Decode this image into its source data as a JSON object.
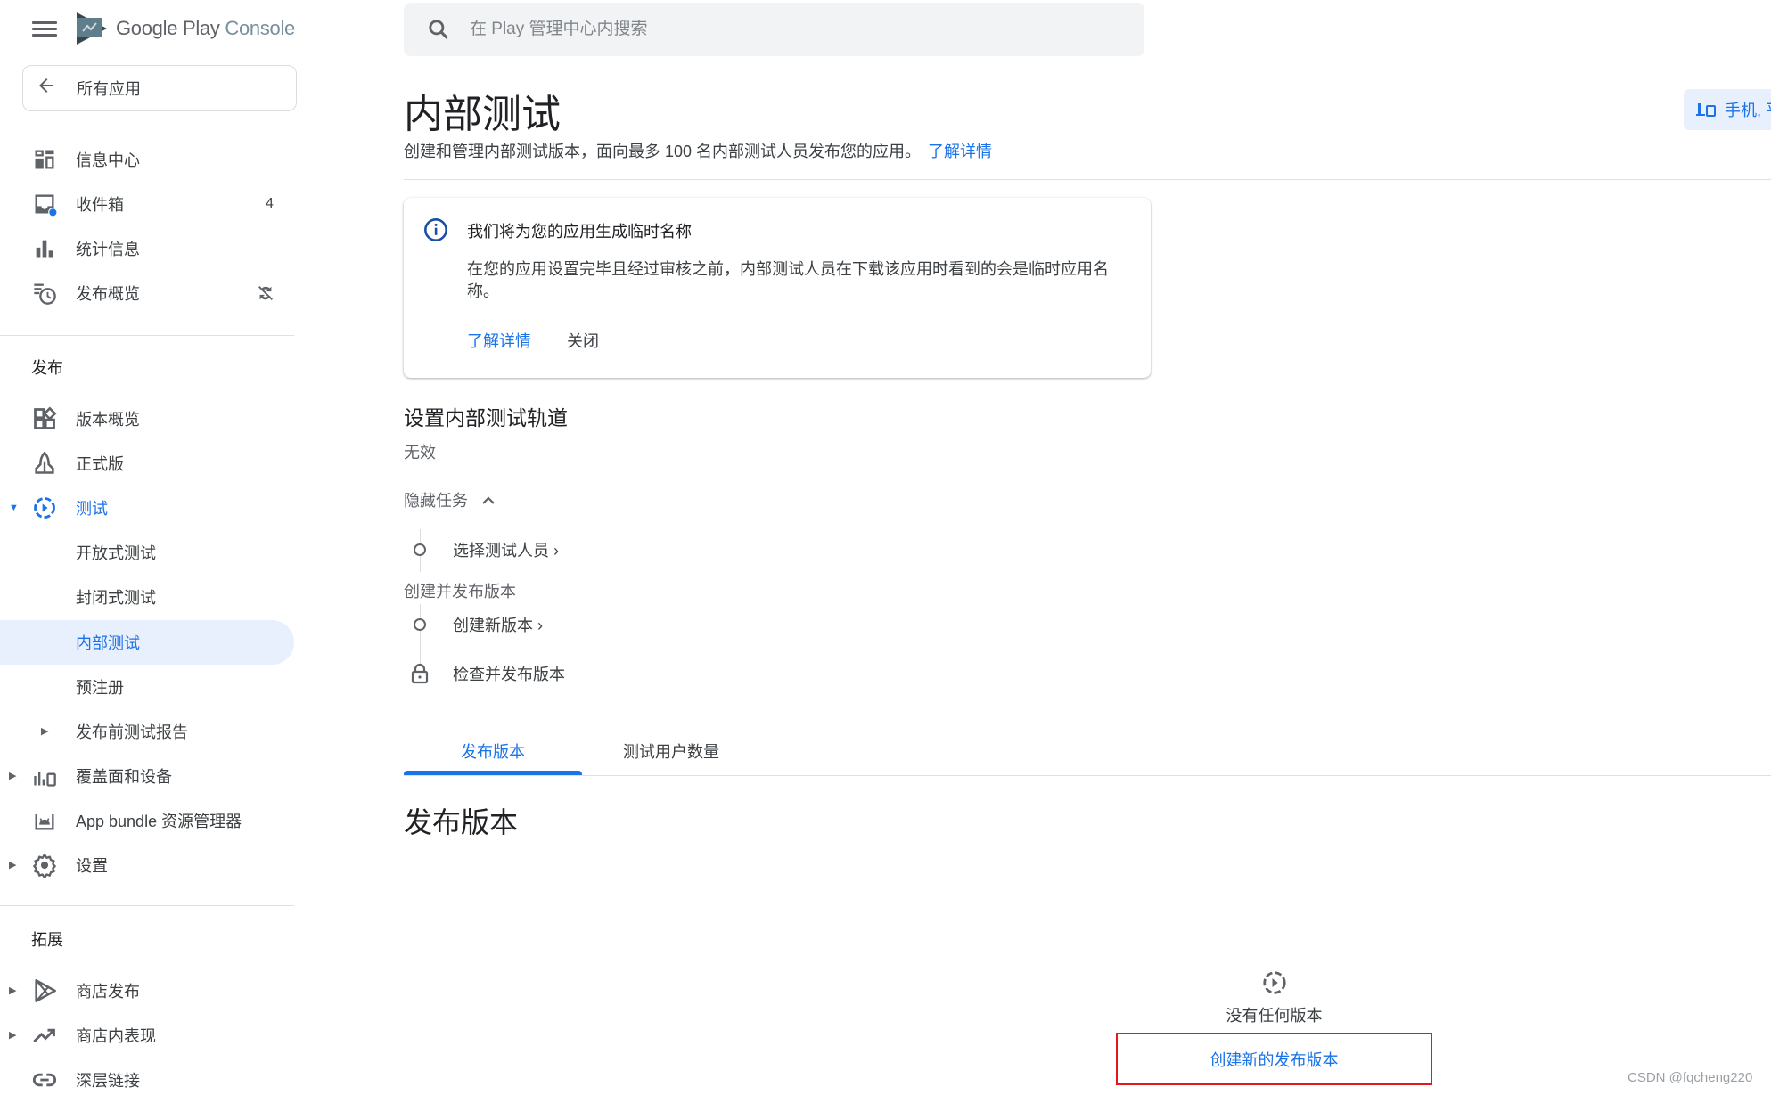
{
  "app": {
    "brand_google_play": "Google Play",
    "brand_console": "Console"
  },
  "sidebar": {
    "all_apps": "所有应用",
    "top_items": [
      {
        "label": "信息中心",
        "icon": "dashboard-icon"
      },
      {
        "label": "收件箱",
        "icon": "inbox-icon",
        "badge": "4"
      },
      {
        "label": "统计信息",
        "icon": "statistics-icon"
      },
      {
        "label": "发布概览",
        "icon": "publishing-overview-icon"
      }
    ],
    "release_section": "发布",
    "release_items": [
      {
        "label": "版本概览",
        "icon": "releases-overview-icon"
      },
      {
        "label": "正式版",
        "icon": "production-icon"
      },
      {
        "label": "测试",
        "icon": "testing-icon",
        "expanded": true
      },
      {
        "label": "开放式测试"
      },
      {
        "label": "封闭式测试"
      },
      {
        "label": "内部测试",
        "selected": true
      },
      {
        "label": "预注册"
      },
      {
        "label": "发布前测试报告"
      },
      {
        "label": "覆盖面和设备",
        "icon": "reach-devices-icon"
      },
      {
        "label": "App bundle 资源管理器",
        "icon": "app-bundle-icon"
      },
      {
        "label": "设置",
        "icon": "settings-icon"
      }
    ],
    "grow_section": "拓展",
    "grow_items": [
      {
        "label": "商店发布",
        "icon": "store-presence-icon"
      },
      {
        "label": "商店内表现",
        "icon": "store-performance-icon"
      },
      {
        "label": "深层链接",
        "icon": "deep-links-icon"
      }
    ]
  },
  "search": {
    "placeholder": "在 Play 管理中心内搜索"
  },
  "device_chip": {
    "label": "手机, 平"
  },
  "page": {
    "title": "内部测试",
    "subtitle": "创建和管理内部测试版本，面向最多 100 名内部测试人员发布您的应用。",
    "learn_more": "了解详情"
  },
  "notice": {
    "title": "我们将为您的应用生成临时名称",
    "body": "在您的应用设置完毕且经过审核之前，内部测试人员在下载该应用时看到的会是临时应用名称。",
    "learn_more": "了解详情",
    "close": "关闭"
  },
  "track": {
    "title": "设置内部测试轨道",
    "status": "无效",
    "hide_tasks": "隐藏任务",
    "steps": [
      {
        "label": "选择测试人员 ›",
        "state": "pending"
      },
      {
        "group": "创建并发布版本"
      },
      {
        "label": "创建新版本 ›",
        "state": "pending"
      },
      {
        "label": "检查并发布版本",
        "state": "locked"
      }
    ]
  },
  "tabs": [
    {
      "label": "发布版本",
      "active": true
    },
    {
      "label": "测试用户数量",
      "active": false
    }
  ],
  "releases": {
    "heading": "发布版本",
    "empty_text": "没有任何版本",
    "create_button": "创建新的发布版本"
  },
  "watermark": "CSDN @fqcheng220",
  "colors": {
    "accent": "#1a73e8",
    "highlight": "#e8f0fe",
    "annotation_box": "#e8151b"
  }
}
